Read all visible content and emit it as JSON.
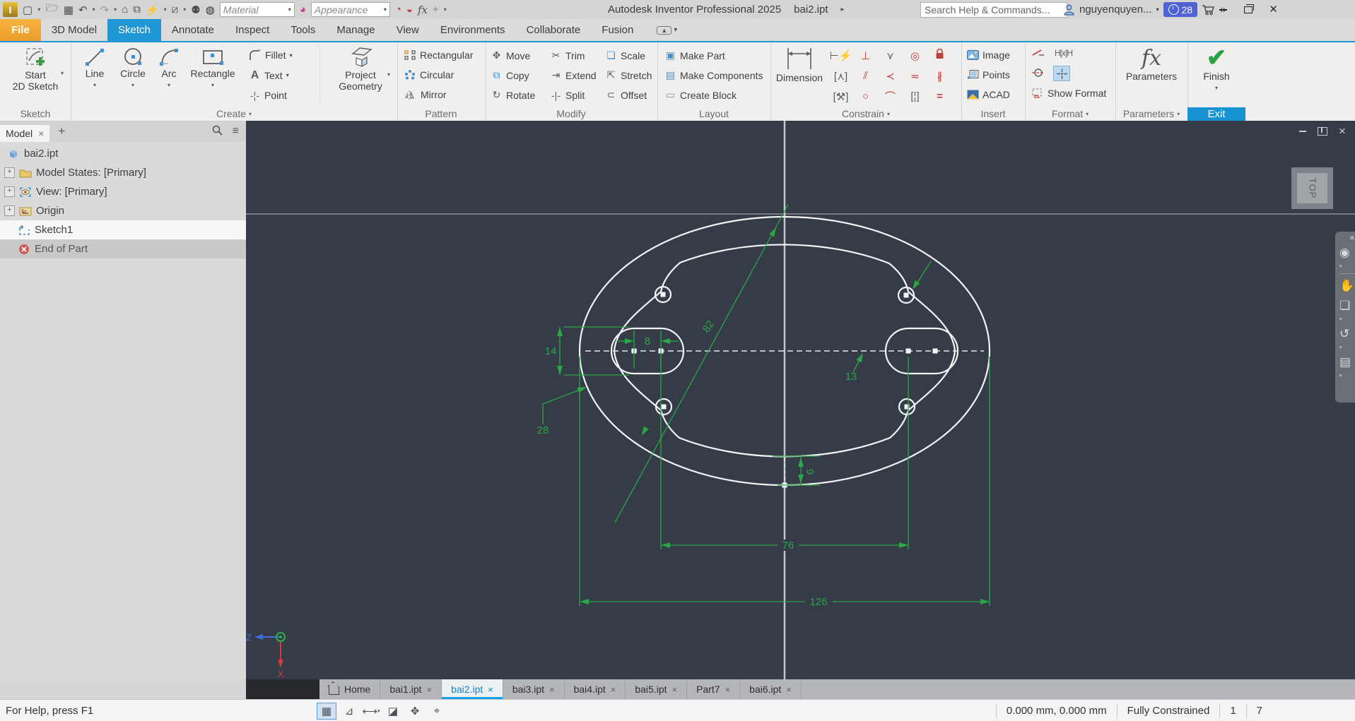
{
  "ui": {
    "dropdown": "▾",
    "close": "×",
    "plus": "+",
    "burger": "≡",
    "chevrons": "»",
    "back": "▸",
    "search_glyph": "⌕"
  },
  "title_bar": {
    "app_title": "Autodesk Inventor Professional 2025",
    "doc_title": "bai2.ipt",
    "material": "Material",
    "appearance": "Appearance",
    "search_placeholder": "Search Help & Commands...",
    "user": "nguyenquyen...",
    "badge": "28"
  },
  "ribbon": {
    "tabs": [
      "File",
      "3D Model",
      "Sketch",
      "Annotate",
      "Inspect",
      "Tools",
      "Manage",
      "View",
      "Environments",
      "Collaborate",
      "Fusion"
    ],
    "sketch": {
      "label": "Sketch",
      "start1": "Start",
      "start2": "2D Sketch"
    },
    "create": {
      "label": "Create",
      "line": "Line",
      "circle": "Circle",
      "arc": "Arc",
      "rectangle": "Rectangle",
      "fillet": "Fillet",
      "text": "Text",
      "point": "Point",
      "project1": "Project",
      "project2": "Geometry"
    },
    "pattern": {
      "label": "Pattern",
      "rectangular": "Rectangular",
      "circular": "Circular",
      "mirror": "Mirror"
    },
    "modify": {
      "label": "Modify",
      "move": "Move",
      "copy": "Copy",
      "rotate": "Rotate",
      "trim": "Trim",
      "extend": "Extend",
      "split": "Split",
      "scale": "Scale",
      "stretch": "Stretch",
      "offset": "Offset"
    },
    "layout": {
      "label": "Layout",
      "make_part": "Make Part",
      "make_components": "Make Components",
      "create_block": "Create Block"
    },
    "constrain": {
      "label": "Constrain",
      "dimension": "Dimension"
    },
    "insert": {
      "label": "Insert",
      "image": "Image",
      "points": "Points",
      "acad": "ACAD"
    },
    "format": {
      "label": "Format",
      "show_format": "Show Format"
    },
    "parameters": {
      "label": "Parameters",
      "button": "Parameters"
    },
    "exit": {
      "label": "Exit",
      "finish": "Finish"
    }
  },
  "browser": {
    "tab": "Model",
    "items": [
      "bai2.ipt",
      "Model States: [Primary]",
      "View: [Primary]",
      "Origin",
      "Sketch1",
      "End of Part"
    ]
  },
  "canvas": {
    "dims": {
      "d82": "82",
      "d14": "14",
      "d8": "8",
      "d28": "28",
      "d13": "13",
      "d9": "9",
      "d76": "76",
      "d126": "126"
    },
    "view_cube": "TOP",
    "axis_z": "Z",
    "axis_x": "X",
    "sketch_color": "#2aa646",
    "geometry_color": "#f2f4f6",
    "background": "#353c48"
  },
  "doc_tabs": [
    "Home",
    "bai1.ipt",
    "bai2.ipt",
    "bai3.ipt",
    "bai4.ipt",
    "bai5.ipt",
    "Part7",
    "bai6.ipt"
  ],
  "status_bar": {
    "help": "For Help, press F1",
    "coords": "0.000 mm, 0.000 mm",
    "constraint": "Fully Constrained",
    "n1": "1",
    "n2": "7"
  }
}
